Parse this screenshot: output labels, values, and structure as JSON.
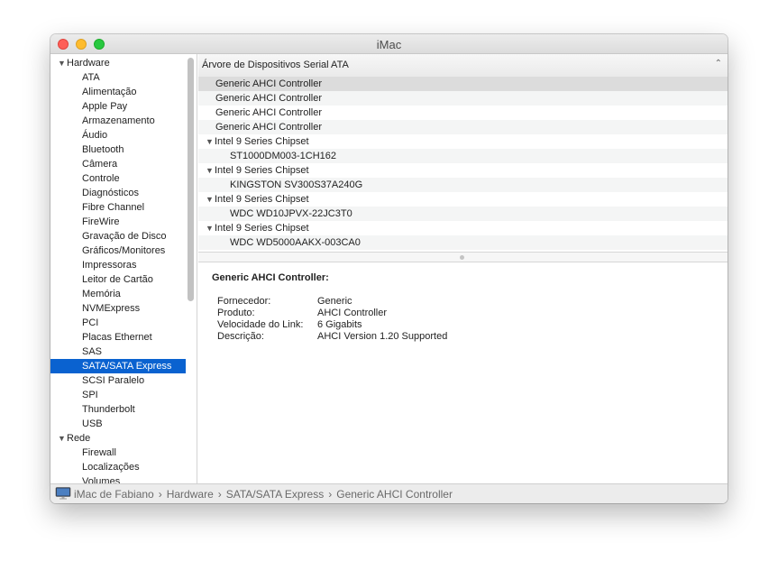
{
  "window": {
    "title": "iMac"
  },
  "sidebar": {
    "items": [
      {
        "label": "Hardware",
        "type": "category"
      },
      {
        "label": "ATA",
        "type": "sub"
      },
      {
        "label": "Alimentação",
        "type": "sub"
      },
      {
        "label": "Apple Pay",
        "type": "sub"
      },
      {
        "label": "Armazenamento",
        "type": "sub"
      },
      {
        "label": "Áudio",
        "type": "sub"
      },
      {
        "label": "Bluetooth",
        "type": "sub"
      },
      {
        "label": "Câmera",
        "type": "sub"
      },
      {
        "label": "Controle",
        "type": "sub"
      },
      {
        "label": "Diagnósticos",
        "type": "sub"
      },
      {
        "label": "Fibre Channel",
        "type": "sub"
      },
      {
        "label": "FireWire",
        "type": "sub"
      },
      {
        "label": "Gravação de Disco",
        "type": "sub"
      },
      {
        "label": "Gráficos/Monitores",
        "type": "sub"
      },
      {
        "label": "Impressoras",
        "type": "sub"
      },
      {
        "label": "Leitor de Cartão",
        "type": "sub"
      },
      {
        "label": "Memória",
        "type": "sub"
      },
      {
        "label": "NVMExpress",
        "type": "sub"
      },
      {
        "label": "PCI",
        "type": "sub"
      },
      {
        "label": "Placas Ethernet",
        "type": "sub"
      },
      {
        "label": "SAS",
        "type": "sub"
      },
      {
        "label": "SATA/SATA Express",
        "type": "sub",
        "selected": true
      },
      {
        "label": "SCSI Paralelo",
        "type": "sub"
      },
      {
        "label": "SPI",
        "type": "sub"
      },
      {
        "label": "Thunderbolt",
        "type": "sub"
      },
      {
        "label": "USB",
        "type": "sub"
      },
      {
        "label": "Rede",
        "type": "category"
      },
      {
        "label": "Firewall",
        "type": "sub"
      },
      {
        "label": "Localizações",
        "type": "sub"
      },
      {
        "label": "Volumes",
        "type": "sub"
      }
    ]
  },
  "tree": {
    "title": "Árvore de Dispositivos Serial ATA",
    "rows": [
      {
        "label": "Generic AHCI Controller",
        "level": 1,
        "selected": true
      },
      {
        "label": "Generic AHCI Controller",
        "level": 1
      },
      {
        "label": "Generic AHCI Controller",
        "level": 1
      },
      {
        "label": "Generic AHCI Controller",
        "level": 1
      },
      {
        "label": "Intel 9 Series Chipset",
        "level": 0,
        "expandable": true
      },
      {
        "label": "ST1000DM003-1CH162",
        "level": 2
      },
      {
        "label": "Intel 9 Series Chipset",
        "level": 0,
        "expandable": true
      },
      {
        "label": "KINGSTON SV300S37A240G",
        "level": 2
      },
      {
        "label": "Intel 9 Series Chipset",
        "level": 0,
        "expandable": true
      },
      {
        "label": "WDC WD10JPVX-22JC3T0",
        "level": 2
      },
      {
        "label": "Intel 9 Series Chipset",
        "level": 0,
        "expandable": true
      },
      {
        "label": "WDC WD5000AAKX-003CA0",
        "level": 2
      }
    ]
  },
  "detail": {
    "title": "Generic AHCI Controller:",
    "fields": [
      {
        "label": "Fornecedor:",
        "value": "Generic"
      },
      {
        "label": "Produto:",
        "value": "AHCI Controller"
      },
      {
        "label": "Velocidade do Link:",
        "value": "6 Gigabits"
      },
      {
        "label": "Descrição:",
        "value": "AHCI Version 1.20 Supported"
      }
    ]
  },
  "statusbar": {
    "breadcrumbs": [
      "iMac de Fabiano",
      "Hardware",
      "SATA/SATA Express",
      "Generic AHCI Controller"
    ],
    "separator": "›",
    "icon": "imac-icon"
  },
  "colors": {
    "selection": "#0a62d0",
    "close": "#fe5f57",
    "minimize": "#febc2e",
    "maximize": "#28c840"
  }
}
